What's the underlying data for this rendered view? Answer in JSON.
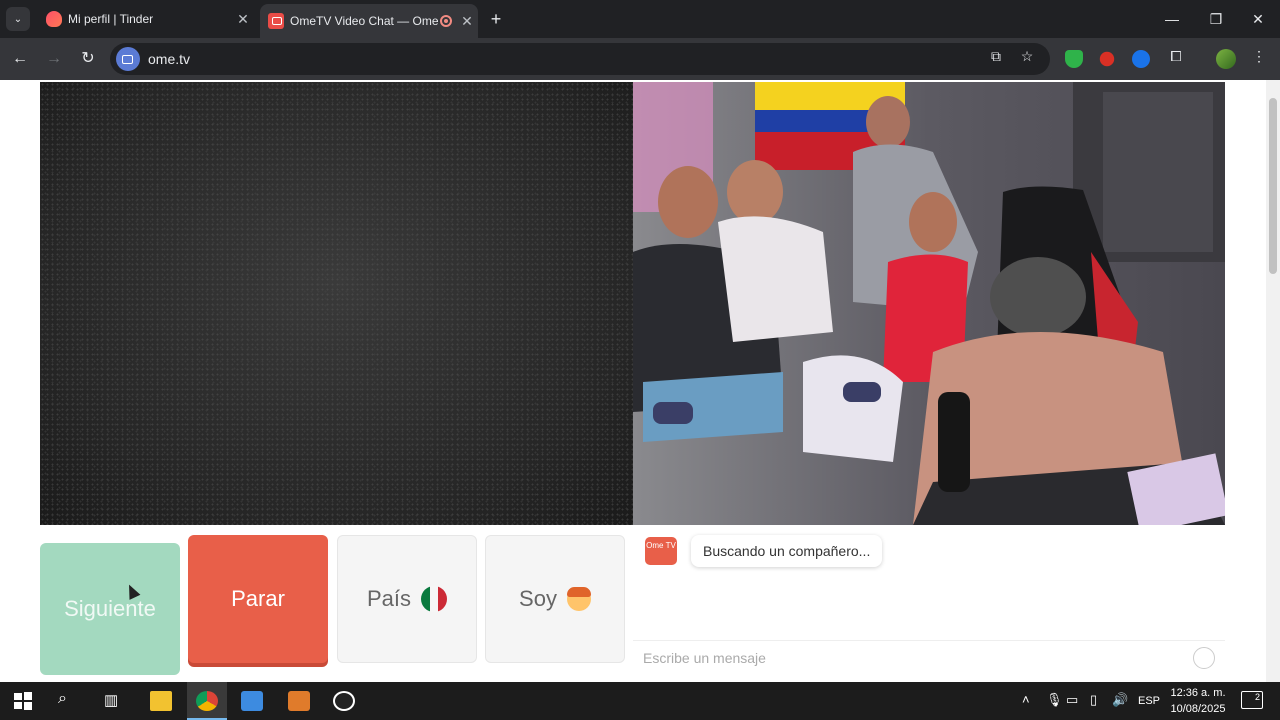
{
  "browser": {
    "tabs": [
      {
        "title": "Mi perfil | Tinder",
        "active": false
      },
      {
        "title": "OmeTV Video Chat — Ome",
        "active": true
      }
    ],
    "url": "ome.tv"
  },
  "controls": {
    "next_label": "Siguiente",
    "stop_label": "Parar",
    "country_label": "País",
    "soy_label": "Soy"
  },
  "chat": {
    "logo": "Ome TV",
    "status_message": "Buscando un compañero...",
    "input_placeholder": "Escribe un mensaje"
  },
  "taskbar": {
    "language": "ESP",
    "time": "12:36 a. m.",
    "date": "10/08/2025",
    "notifications": "2"
  },
  "colors": {
    "next": "#a3d9bf",
    "stop": "#e85f49",
    "accent": "#e85f49"
  }
}
